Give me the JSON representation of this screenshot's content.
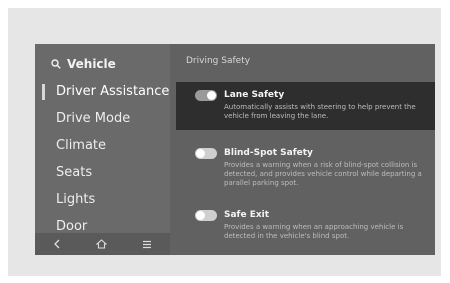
{
  "sidebar": {
    "search_label": "Vehicle",
    "items": [
      {
        "label": "Driver Assistance",
        "active": true
      },
      {
        "label": "Drive Mode",
        "active": false
      },
      {
        "label": "Climate",
        "active": false
      },
      {
        "label": "Seats",
        "active": false
      },
      {
        "label": "Lights",
        "active": false
      },
      {
        "label": "Door",
        "active": false
      }
    ],
    "nav_icons": [
      "back-icon",
      "home-icon",
      "menu-icon"
    ]
  },
  "main": {
    "section_title": "Driving Safety",
    "settings": [
      {
        "title": "Lane Safety",
        "description": "Automatically assists with steering to help prevent the vehicle from leaving the lane.",
        "enabled": true,
        "highlighted": true
      },
      {
        "title": "Blind-Spot Safety",
        "description": "Provides a warning when a risk of blind-spot collision is detected, and provides vehicle control while departing a parallel parking spot.",
        "enabled": false,
        "highlighted": false
      },
      {
        "title": "Safe Exit",
        "description": "Provides a warning when an approaching vehicle is detected in the vehicle's blind spot.",
        "enabled": false,
        "highlighted": false
      }
    ]
  },
  "colors": {
    "screen_bg": "#616161",
    "sidebar_bg": "#6a6a6a",
    "highlight_bg": "#2e2e2e",
    "frame_bg": "#e6e6e6"
  }
}
